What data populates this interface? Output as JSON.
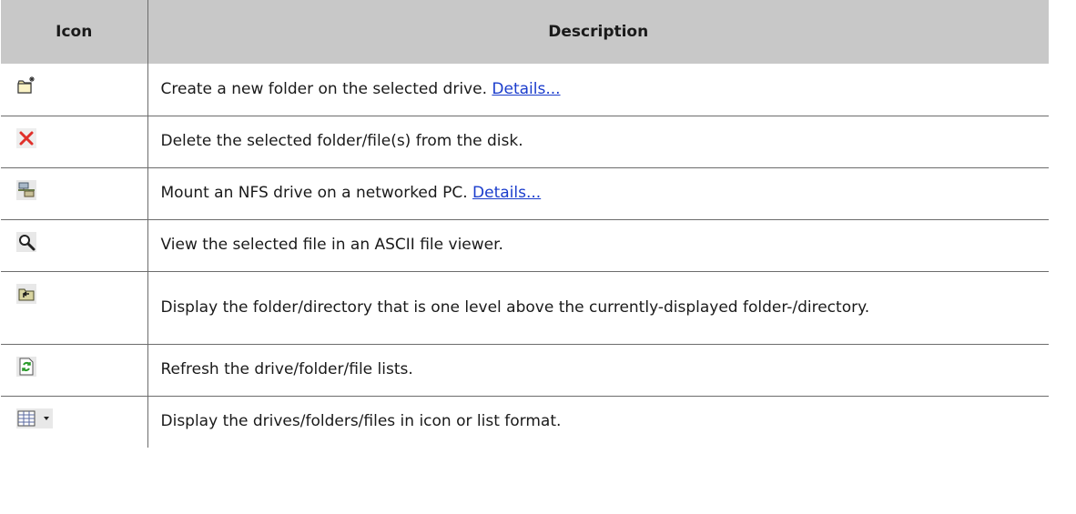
{
  "table": {
    "headers": [
      "Icon",
      "Description"
    ],
    "rows": [
      {
        "icon": "new-folder-icon",
        "text": "Create a new folder on the selected drive.",
        "link": "Details..."
      },
      {
        "icon": "delete-x-icon",
        "text": "Delete the selected folder/file(s) from the disk."
      },
      {
        "icon": "mount-nfs-icon",
        "text": "Mount an NFS drive on a networked PC.",
        "link": "Details..."
      },
      {
        "icon": "magnifier-icon",
        "text": "View the selected file in an ASCII file viewer."
      },
      {
        "icon": "folder-up-icon",
        "text": "Display the folder/directory that is one level above the currently-displayed folder-/directory."
      },
      {
        "icon": "refresh-icon",
        "text": "Refresh the drive/folder/file lists."
      },
      {
        "icon": "view-format-dropdown-icon",
        "text": "Display the drives/folders/files in icon or list format."
      }
    ]
  },
  "colors": {
    "header_bg": "#c8c8c8",
    "border": "#6c6c6c",
    "link": "#1a3ccc",
    "delete_icon": "#e0302a"
  }
}
